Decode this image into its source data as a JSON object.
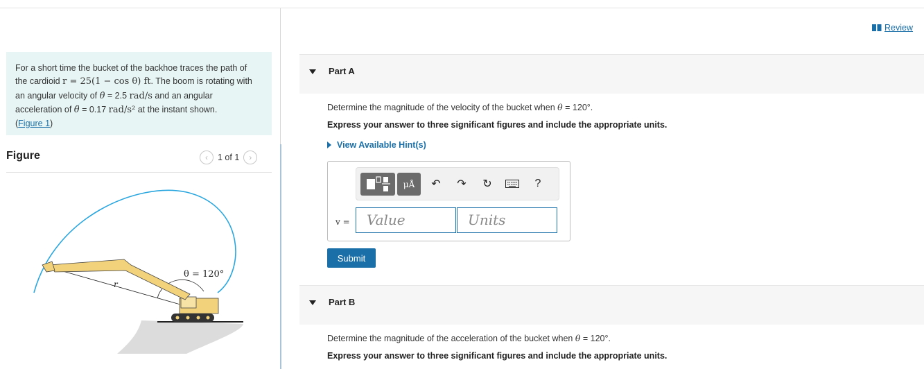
{
  "problem": {
    "line1": "For a short time the bucket of the backhoe traces the path of",
    "line2_a": "the cardioid ",
    "line2_math": "r = 25(1 − cos θ) ft",
    "line2_b": ". The boom is rotating with",
    "line3_a": "an angular velocity of ",
    "line3_math1": "θ̇",
    "line3_b": " = 2.5 ",
    "line3_unit": "rad/s",
    "line3_c": " and an angular",
    "line4_a": "acceleration of ",
    "line4_math1": "θ̈",
    "line4_b": " = 0.17 ",
    "line4_unit": "rad/s²",
    "line4_c": " at the instant shown.",
    "figure_link": "Figure 1",
    "figure_link_open": "(",
    "figure_link_close": ")"
  },
  "figure": {
    "header": "Figure",
    "pager": "1 of 1",
    "prev_icon": "chevron-left-icon",
    "next_icon": "chevron-right-icon",
    "angle_label": "θ = 120°",
    "r_label": "r"
  },
  "review": {
    "label": "Review",
    "icon": "book-icon"
  },
  "partA": {
    "label": "Part A",
    "question_a": "Determine the magnitude of the velocity of the bucket when ",
    "question_math": "θ",
    "question_b": " = 120",
    "question_c": "°.",
    "instruction": "Express your answer to three significant figures and include the appropriate units.",
    "hint": "View Available Hint(s)",
    "var_label": "v =",
    "value_placeholder": "Value",
    "units_placeholder": "Units",
    "submit": "Submit",
    "toolbar": {
      "mu_label": "μÅ",
      "help": "?",
      "icons": [
        "templates-icon",
        "undo-icon",
        "redo-icon",
        "reset-icon",
        "keyboard-icon",
        "help-icon"
      ]
    }
  },
  "partB": {
    "label": "Part B",
    "question_a": "Determine the magnitude of the acceleration of the bucket when ",
    "question_math": "θ",
    "question_b": " = 120",
    "question_c": "°.",
    "instruction": "Express your answer to three significant figures and include the appropriate units."
  },
  "colors": {
    "accent": "#1a6fa8",
    "problem_bg": "#e8f5f5",
    "curve": "#2aa6df",
    "machine": "#f2d27a"
  }
}
